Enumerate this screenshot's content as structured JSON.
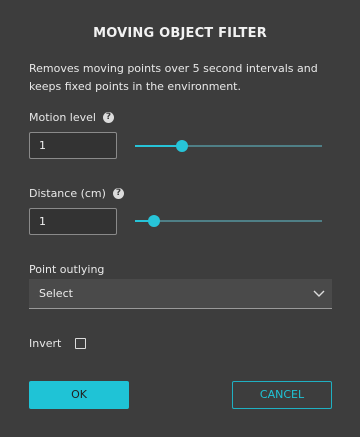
{
  "dialog": {
    "title": "MOVING OBJECT FILTER",
    "description": "Removes moving points over 5 second intervals and keeps fixed points in the environment."
  },
  "motion_level": {
    "label": "Motion level",
    "help_icon": "question-circle-icon",
    "value": "1",
    "slider_fraction": 0.25
  },
  "distance": {
    "label": "Distance (cm)",
    "help_icon": "question-circle-icon",
    "value": "1",
    "slider_fraction": 0.1
  },
  "point_outlying": {
    "label": "Point outlying",
    "selected": "Select",
    "icon": "chevron-down-icon"
  },
  "invert": {
    "label": "Invert",
    "checked": false
  },
  "buttons": {
    "ok": "OK",
    "cancel": "CANCEL"
  },
  "colors": {
    "accent": "#1fc3d6",
    "background": "#3d3d3d"
  }
}
